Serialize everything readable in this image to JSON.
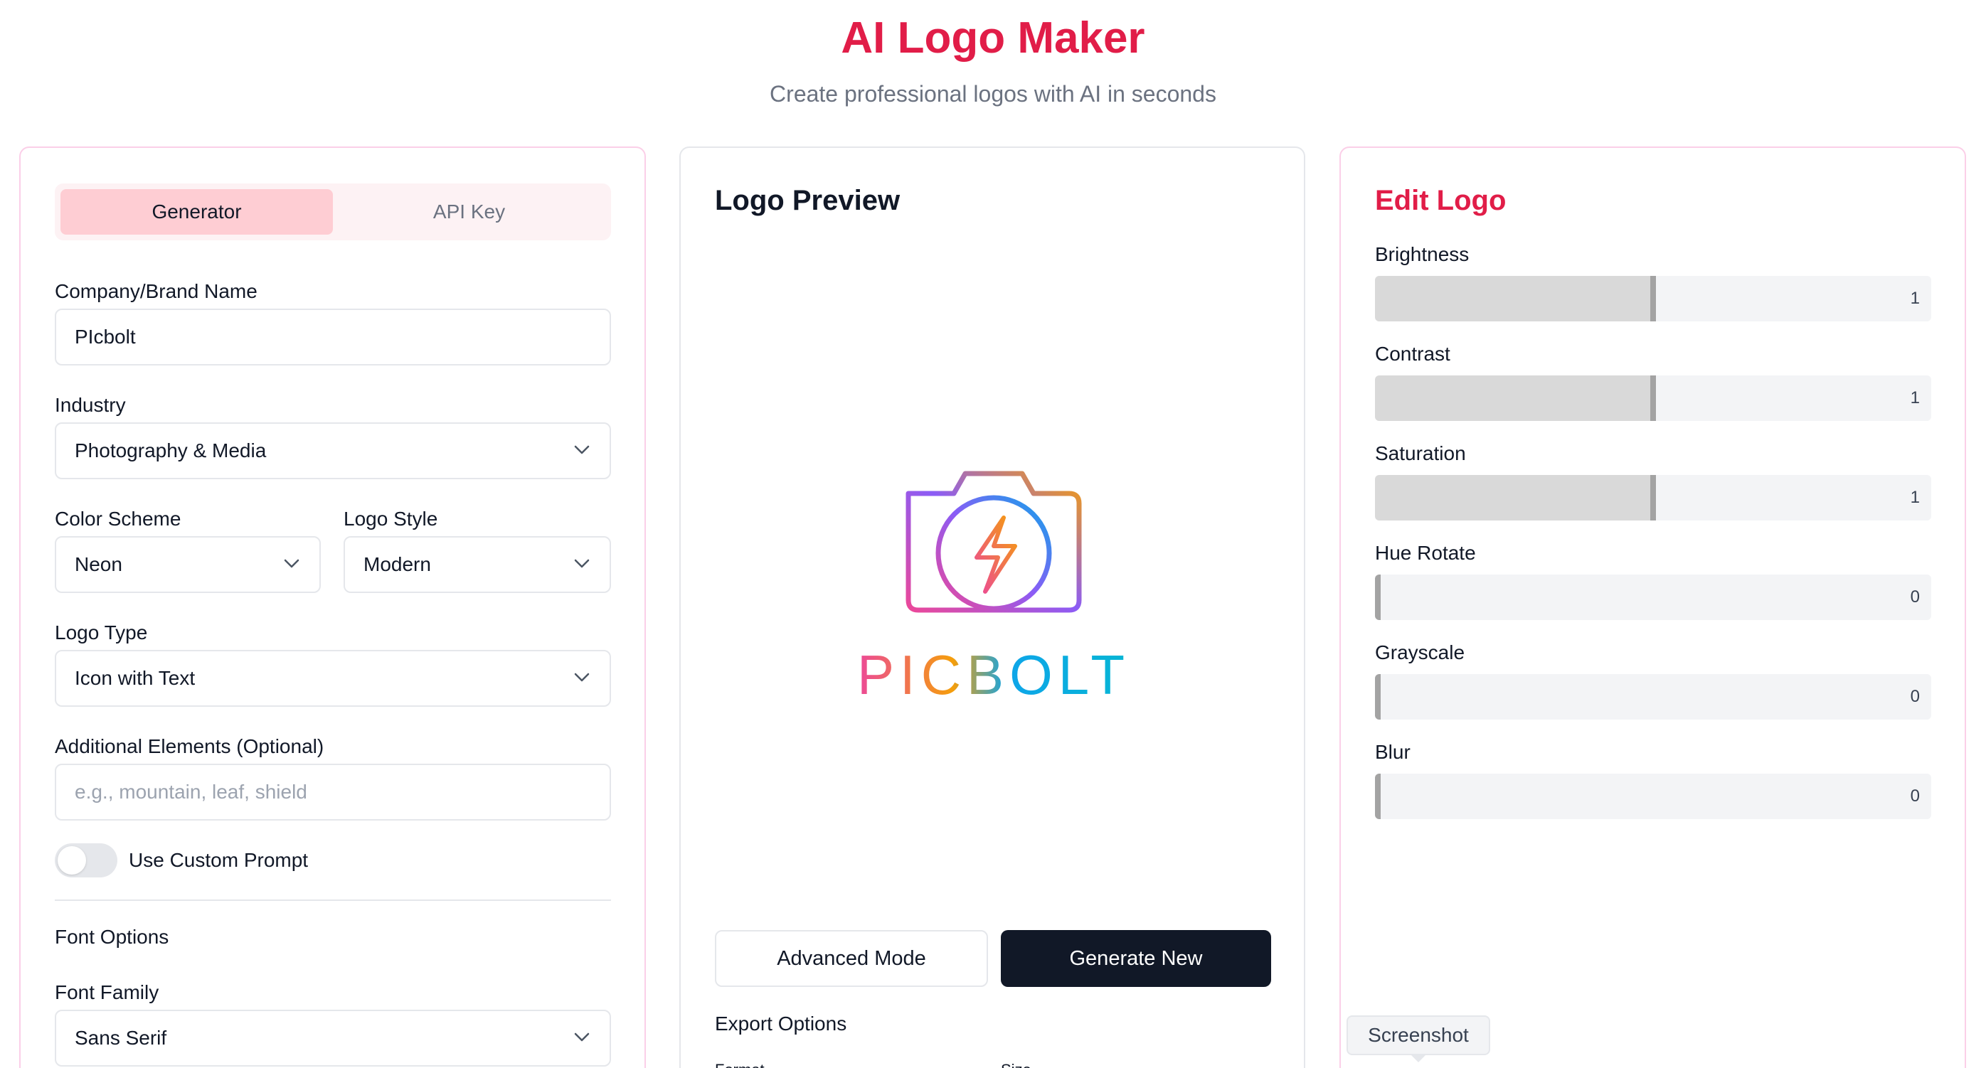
{
  "header": {
    "title": "AI Logo Maker",
    "subtitle": "Create professional logos with AI in seconds"
  },
  "colors": {
    "accent": "#e11d48",
    "tab_active_bg": "#fecdd3",
    "dark_button": "#111827"
  },
  "generator": {
    "tabs": [
      {
        "label": "Generator",
        "active": true
      },
      {
        "label": "API Key",
        "active": false
      }
    ],
    "company": {
      "label": "Company/Brand Name",
      "value": "PIcbolt"
    },
    "industry": {
      "label": "Industry",
      "value": "Photography & Media"
    },
    "color_scheme": {
      "label": "Color Scheme",
      "value": "Neon"
    },
    "logo_style": {
      "label": "Logo Style",
      "value": "Modern"
    },
    "logo_type": {
      "label": "Logo Type",
      "value": "Icon with Text"
    },
    "additional": {
      "label": "Additional Elements (Optional)",
      "placeholder": "e.g., mountain, leaf, shield"
    },
    "custom_prompt": {
      "label": "Use Custom Prompt",
      "enabled": false
    },
    "font_options": {
      "label": "Font Options"
    },
    "font_family": {
      "label": "Font Family",
      "value": "Sans Serif"
    }
  },
  "preview": {
    "title": "Logo Preview",
    "logo_text": "PICBOLT",
    "advanced_mode_label": "Advanced Mode",
    "generate_new_label": "Generate New",
    "export_options_label": "Export Options",
    "format_label": "Format",
    "size_label": "Size"
  },
  "edit": {
    "title": "Edit Logo",
    "sliders": [
      {
        "label": "Brightness",
        "value": "1",
        "fraction": 0.5
      },
      {
        "label": "Contrast",
        "value": "1",
        "fraction": 0.5
      },
      {
        "label": "Saturation",
        "value": "1",
        "fraction": 0.5
      },
      {
        "label": "Hue Rotate",
        "value": "0",
        "fraction": 0
      },
      {
        "label": "Grayscale",
        "value": "0",
        "fraction": 0
      },
      {
        "label": "Blur",
        "value": "0",
        "fraction": 0
      }
    ]
  },
  "tooltip": {
    "label": "Screenshot"
  }
}
